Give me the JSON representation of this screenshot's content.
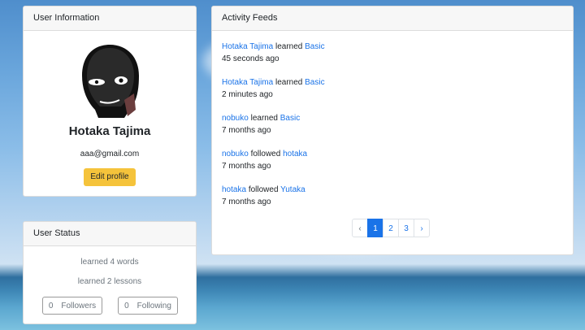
{
  "colors": {
    "accent": "#1a73e8",
    "button_yellow": "#f5c33b"
  },
  "user_info": {
    "header": "User Information",
    "avatar_icon": "masked-face-avatar",
    "name": "Hotaka Tajima",
    "email": "aaa@gmail.com",
    "edit_label": "Edit profile"
  },
  "user_status": {
    "header": "User Status",
    "words": "learned 4 words",
    "lessons": "learned 2 lessons",
    "followers_count": "0",
    "followers_label": "Followers",
    "following_count": "0",
    "following_label": "Following"
  },
  "activity": {
    "header": "Activity Feeds",
    "feeds": [
      {
        "actor": "Hotaka Tajima",
        "verb": "learned",
        "target": "Basic",
        "time": "45 seconds ago"
      },
      {
        "actor": "Hotaka Tajima",
        "verb": "learned",
        "target": "Basic",
        "time": "2 minutes ago"
      },
      {
        "actor": "nobuko",
        "verb": "learned",
        "target": "Basic",
        "time": "7 months ago"
      },
      {
        "actor": "nobuko",
        "verb": "followed",
        "target": "hotaka",
        "time": "7 months ago"
      },
      {
        "actor": "hotaka",
        "verb": "followed",
        "target": "Yutaka",
        "time": "7 months ago"
      }
    ],
    "pagination": {
      "prev": "‹",
      "pages": [
        "1",
        "2",
        "3"
      ],
      "current": "1",
      "next": "›"
    }
  }
}
